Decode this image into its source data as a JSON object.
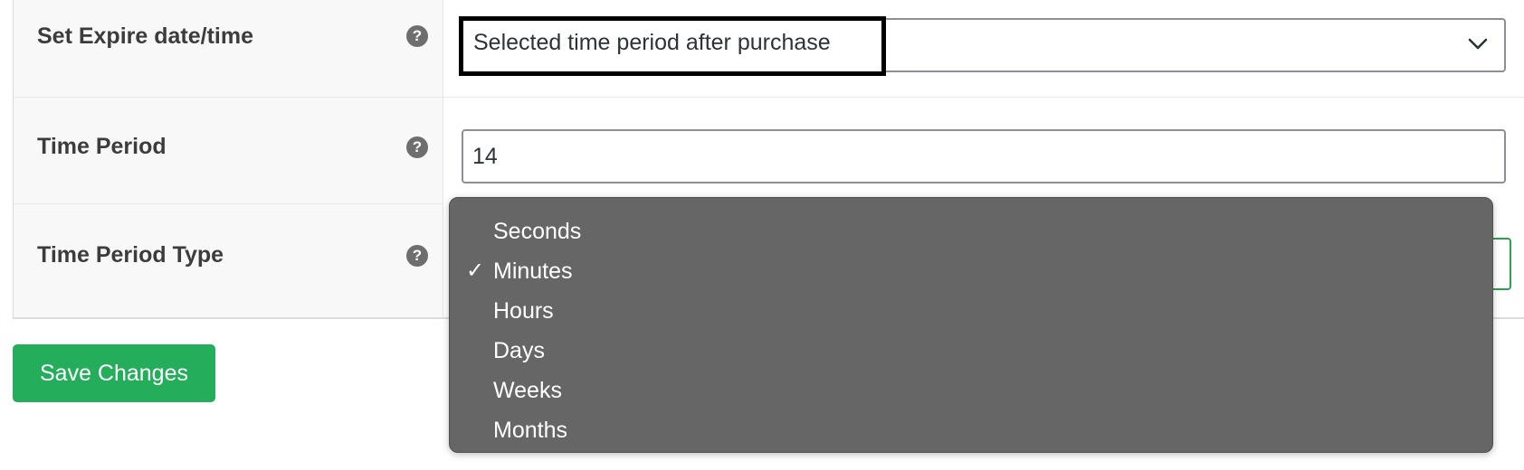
{
  "form": {
    "rows": [
      {
        "label": "Set Expire date/time",
        "help_icon": "question-mark-icon",
        "help_glyph": "?",
        "field_type": "select",
        "value": "Selected time period after purchase"
      },
      {
        "label": "Time Period",
        "help_icon": "question-mark-icon",
        "help_glyph": "?",
        "field_type": "text",
        "value": "14"
      },
      {
        "label": "Time Period Type",
        "help_icon": "question-mark-icon",
        "help_glyph": "?",
        "field_type": "select",
        "value": "Minutes"
      }
    ]
  },
  "dropdown": {
    "open": true,
    "selected_index": 1,
    "check_glyph": "✓",
    "options": [
      "Seconds",
      "Minutes",
      "Hours",
      "Days",
      "Weeks",
      "Months"
    ]
  },
  "actions": {
    "save_label": "Save Changes"
  },
  "colors": {
    "save_button_bg": "#24ad5b",
    "dropdown_bg": "#666666",
    "focus_border": "#2fa04f",
    "highlight_border": "#000000"
  }
}
